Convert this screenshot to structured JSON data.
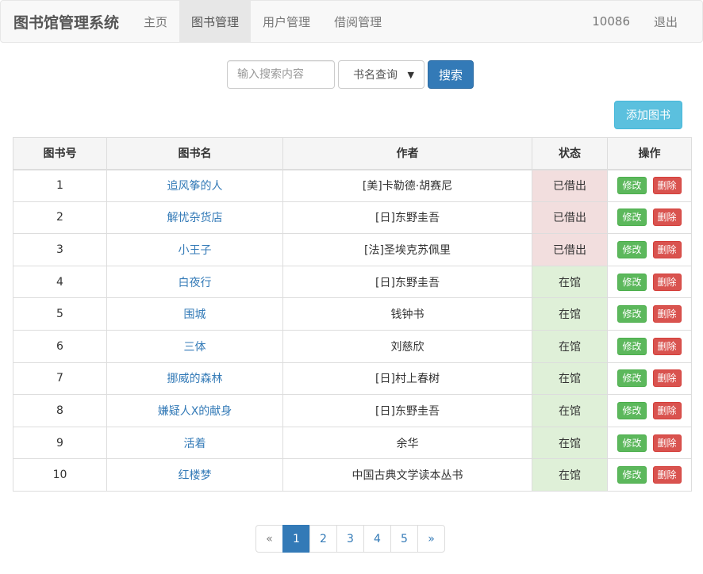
{
  "navbar": {
    "brand": "图书馆管理系统",
    "items": [
      {
        "label": "主页",
        "active": false
      },
      {
        "label": "图书管理",
        "active": true
      },
      {
        "label": "用户管理",
        "active": false
      },
      {
        "label": "借阅管理",
        "active": false
      }
    ],
    "user_id": "10086",
    "logout_label": "退出"
  },
  "search": {
    "placeholder": "输入搜索内容",
    "value": "",
    "mode_selected": "书名查询",
    "button_label": "搜索"
  },
  "add_button_label": "添加图书",
  "table": {
    "headers": [
      "图书号",
      "图书名",
      "作者",
      "状态",
      "操作"
    ],
    "edit_label": "修改",
    "delete_label": "删除",
    "rows": [
      {
        "id": "1",
        "title": "追风筝的人",
        "author": "[美]卡勒德·胡赛尼",
        "status": "已借出"
      },
      {
        "id": "2",
        "title": "解忧杂货店",
        "author": "[日]东野圭吾",
        "status": "已借出"
      },
      {
        "id": "3",
        "title": "小王子",
        "author": "[法]圣埃克苏佩里",
        "status": "已借出"
      },
      {
        "id": "4",
        "title": "白夜行",
        "author": "[日]东野圭吾",
        "status": "在馆"
      },
      {
        "id": "5",
        "title": "围城",
        "author": "钱钟书",
        "status": "在馆"
      },
      {
        "id": "6",
        "title": "三体",
        "author": "刘慈欣",
        "status": "在馆"
      },
      {
        "id": "7",
        "title": "挪威的森林",
        "author": "[日]村上春树",
        "status": "在馆"
      },
      {
        "id": "8",
        "title": "嫌疑人X的献身",
        "author": "[日]东野圭吾",
        "status": "在馆"
      },
      {
        "id": "9",
        "title": "活着",
        "author": "余华",
        "status": "在馆"
      },
      {
        "id": "10",
        "title": "红楼梦",
        "author": "中国古典文学读本丛书",
        "status": "在馆"
      }
    ]
  },
  "pagination": {
    "prev": "«",
    "pages": [
      "1",
      "2",
      "3",
      "4",
      "5"
    ],
    "current": "1",
    "next": "»"
  },
  "colors": {
    "primary": "#337ab7",
    "info": "#5bc0de",
    "success": "#5cb85c",
    "danger": "#d9534f",
    "status_out_bg": "#f2dede",
    "status_in_bg": "#dff0d8"
  }
}
